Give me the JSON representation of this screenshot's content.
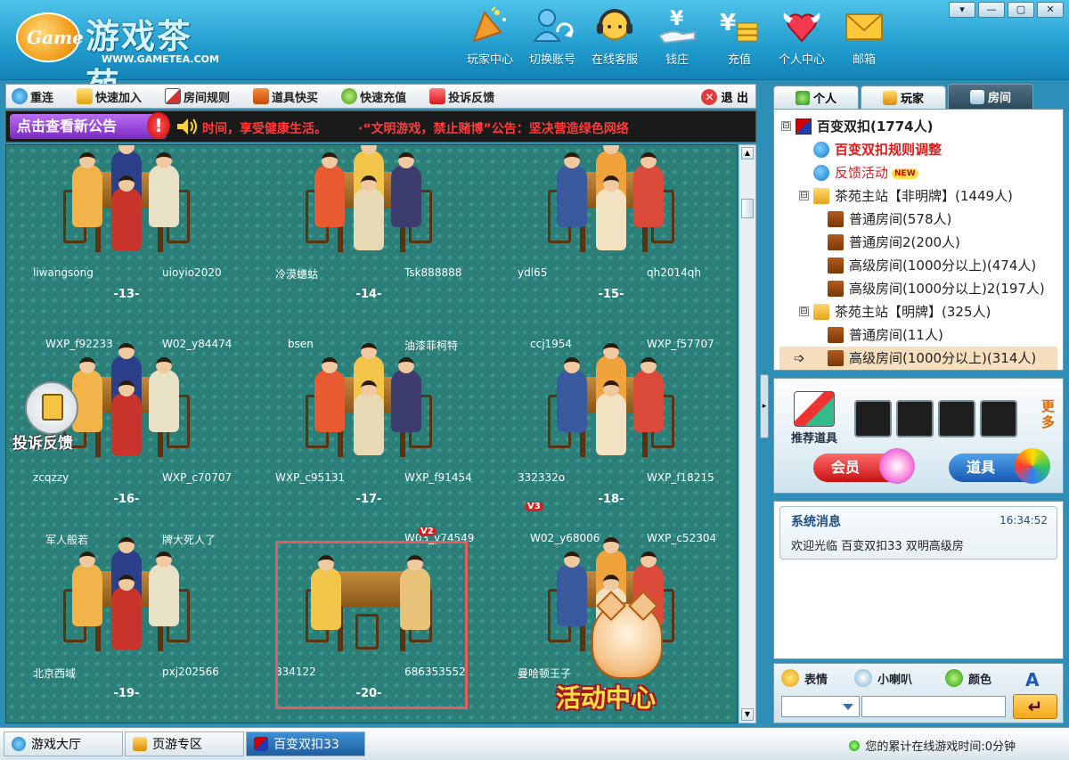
{
  "app": {
    "logo_text": "游戏茶苑",
    "logo_mark": "Game",
    "logo_url": "WWW.GAMETEA.COM"
  },
  "top_nav": [
    {
      "label": "玩家中心",
      "icon": "party-popper-icon"
    },
    {
      "label": "切换账号",
      "icon": "switch-account-icon"
    },
    {
      "label": "在线客服",
      "icon": "headset-icon"
    },
    {
      "label": "钱庄",
      "icon": "money-hand-icon"
    },
    {
      "label": "充值",
      "icon": "recharge-icon"
    },
    {
      "label": "个人中心",
      "icon": "heart-wings-icon"
    },
    {
      "label": "邮箱",
      "icon": "envelope-icon"
    }
  ],
  "window_controls": [
    "▾",
    "—",
    "▢",
    "✕"
  ],
  "toolbar": {
    "items": [
      "重连",
      "快速加入",
      "房间规则",
      "道具快买",
      "快速充值",
      "投诉反馈"
    ],
    "exit_label": "退 出"
  },
  "announcement": {
    "button_label": "点击查看新公告",
    "text": "时间，享受健康生活。　　　·“文明游戏，禁止赌博”公告：坚决营造绿色网络"
  },
  "tables": [
    {
      "number": "-13-",
      "left_top": "",
      "right_top": "",
      "left_bottom": "liwangsong",
      "right_bottom": "uioyio2020"
    },
    {
      "number": "-14-",
      "left_top": "",
      "right_top": "",
      "left_bottom": "冷漠蟪蛄",
      "right_bottom": "Tsk888888"
    },
    {
      "number": "-15-",
      "left_top": "",
      "right_top": "",
      "left_bottom": "ydl65",
      "right_bottom": "qh2014qh"
    },
    {
      "number": "-16-",
      "left_top": "WXP_f92233",
      "right_top": "W02_y84474",
      "left_bottom": "zcqzzy",
      "right_bottom": "WXP_c70707"
    },
    {
      "number": "-17-",
      "left_top": "bsen",
      "right_top": "油漆菲柯特",
      "left_bottom": "WXP_c95131",
      "right_bottom": "WXP_f91454"
    },
    {
      "number": "-18-",
      "left_top": "ccj1954",
      "right_top": "WXP_f57707",
      "left_bottom": "332332o",
      "right_bottom": "WXP_f18215"
    },
    {
      "number": "-19-",
      "left_top": "军人般若",
      "right_top": "牌大死人了",
      "left_bottom": "北京西域",
      "right_bottom": "pxj202566"
    },
    {
      "number": "-20-",
      "left_top": "",
      "right_top": "W03_y74549",
      "left_bottom": "834122",
      "right_bottom": "686353552"
    },
    {
      "number": "-21-",
      "left_top": "W02_y68006",
      "right_top": "WXP_c52304",
      "left_bottom": "曼哈顿王子",
      "right_bottom": ""
    }
  ],
  "vip_badges": [
    "V2",
    "V3"
  ],
  "float_buttons": {
    "feedback": "投诉反馈",
    "activity": "活动中心"
  },
  "right_tabs": [
    {
      "label": "个人",
      "active": false
    },
    {
      "label": "玩家",
      "active": false
    },
    {
      "label": "房间",
      "active": true
    }
  ],
  "room_tree": [
    {
      "level": 0,
      "toggle": "⊟",
      "icon": "game",
      "text": "百变双扣(1774人)",
      "style": "bold"
    },
    {
      "level": 1,
      "toggle": "",
      "icon": "ie",
      "text": "百变双扣规则调整",
      "style": "red"
    },
    {
      "level": 1,
      "toggle": "",
      "icon": "ie",
      "text": "反馈活动",
      "style": "redlink",
      "badge": "NEW"
    },
    {
      "level": 1,
      "toggle": "⊟",
      "icon": "folder",
      "text": "茶苑主站【非明牌】(1449人)",
      "style": ""
    },
    {
      "level": 2,
      "toggle": "",
      "icon": "door",
      "text": "普通房间(578人)",
      "style": ""
    },
    {
      "level": 2,
      "toggle": "",
      "icon": "door",
      "text": "普通房间2(200人)",
      "style": ""
    },
    {
      "level": 2,
      "toggle": "",
      "icon": "door",
      "text": "高级房间(1000分以上)(474人)",
      "style": ""
    },
    {
      "level": 2,
      "toggle": "",
      "icon": "door",
      "text": "高级房间(1000分以上)2(197人)",
      "style": ""
    },
    {
      "level": 1,
      "toggle": "⊟",
      "icon": "folder",
      "text": "茶苑主站【明牌】(325人)",
      "style": ""
    },
    {
      "level": 2,
      "toggle": "",
      "icon": "door",
      "text": "普通房间(11人)",
      "style": ""
    },
    {
      "level": 2,
      "toggle": "",
      "icon": "door",
      "text": "高级房间(1000分以上)(314人)",
      "style": "",
      "selected": true,
      "pointer": "➩"
    }
  ],
  "props_panel": {
    "recommend_label": "推荐道具",
    "more_label": "更多",
    "member_label": "会员",
    "props_label": "道具"
  },
  "system_message": {
    "title": "系统消息",
    "time": "16:34:52",
    "text": "欢迎光临 百变双扣33 双明高级房"
  },
  "chat_bar": {
    "emoji_label": "表情",
    "horn_label": "小喇叭",
    "color_label": "颜色",
    "font_label": "A",
    "send_label": "↵"
  },
  "status_bar": {
    "tabs": [
      {
        "label": "游戏大厅",
        "active": false
      },
      {
        "label": "页游专区",
        "active": false
      },
      {
        "label": "百变双扣33",
        "active": true
      }
    ],
    "online_time": "您的累计在线游戏时间:0分钟"
  },
  "colors": {
    "header_blue": "#1c96c9",
    "lobby_teal": "#2b7f78",
    "alert_red": "#e21a1a",
    "highlight_box": "#ec5b5b"
  }
}
